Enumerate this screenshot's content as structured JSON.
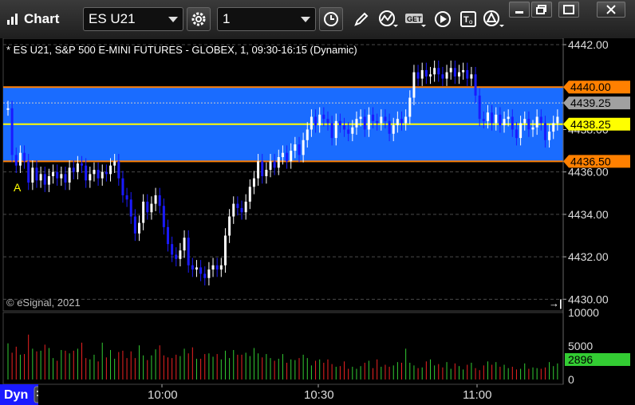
{
  "window": {
    "title": "Chart",
    "symbol": "ES U21",
    "interval": "1",
    "controls": [
      "minimize-icon",
      "restore-icon",
      "maximize-icon",
      "close-icon"
    ]
  },
  "toolbar": {
    "icons": [
      "settings-gear-icon",
      "clock-icon",
      "pencil-icon",
      "study-icon",
      "get-icon",
      "play-icon",
      "text-icon",
      "alert-icon"
    ]
  },
  "chart": {
    "header": "* ES U21, S&P 500 E-MINI FUTURES - GLOBEX, 1, 09:30-16:15 (Dynamic)",
    "copyright": "© eSignal, 2021",
    "marker": "A",
    "price_labels": [
      {
        "text": "4440.00",
        "bg": "#ff8000",
        "fg": "#000000"
      },
      {
        "text": "4439.25",
        "bg": "#a0a0a0",
        "fg": "#000000"
      },
      {
        "text": "4438.25",
        "bg": "#ffff00",
        "fg": "#000000"
      },
      {
        "text": "4436.50",
        "bg": "#ff8000",
        "fg": "#000000"
      }
    ],
    "volume_last": "2896",
    "footer_label": "Dyn",
    "colors": {
      "up": "#ffffff",
      "down": "#1a1aff",
      "zone": "#1a6cff",
      "zone_line": "#ff8000",
      "last_line": "#ffff00",
      "grid": "#4a4a4a"
    }
  },
  "chart_data": {
    "type": "candlestick",
    "title": "* ES U21, S&P 500 E-MINI FUTURES - GLOBEX, 1, 09:30-16:15 (Dynamic)",
    "y_ticks": [
      "4442.00",
      "4438.00",
      "4436.00",
      "4434.00",
      "4432.00",
      "4430.00"
    ],
    "ylim": [
      4429.9,
      4442.0
    ],
    "x_ticks": [
      "10:00",
      "10:30",
      "11:00"
    ],
    "volume_ticks": [
      "10000",
      "5000",
      "0"
    ],
    "zone": {
      "high": 4440.0,
      "low": 4436.5
    },
    "last_price": 4438.25,
    "mid_price": 4439.25,
    "closes": [
      4439.0,
      4436.8,
      4436.3,
      4436.9,
      4436.5,
      4435.5,
      4436.2,
      4435.6,
      4435.9,
      4435.4,
      4435.8,
      4436.0,
      4435.7,
      4435.9,
      4435.5,
      4436.2,
      4436.0,
      4436.4,
      4436.3,
      4435.6,
      4435.9,
      4436.1,
      4435.7,
      4436.0,
      4435.9,
      4436.3,
      4436.5,
      4435.7,
      4434.9,
      4434.7,
      4433.9,
      4433.1,
      4433.6,
      4434.6,
      4434.1,
      4434.5,
      4434.9,
      4434.4,
      4433.4,
      4432.6,
      4432.1,
      4431.9,
      4432.3,
      4432.9,
      4431.6,
      4431.4,
      4431.5,
      4431.2,
      4431.0,
      4431.4,
      4431.6,
      4431.4,
      4431.6,
      4433.0,
      4433.9,
      4434.5,
      4434.3,
      4434.1,
      4434.6,
      4435.3,
      4435.7,
      4436.5,
      4435.8,
      4436.1,
      4436.5,
      4436.2,
      4436.7,
      4436.9,
      4436.5,
      4437.0,
      4437.3,
      4436.8,
      4437.5,
      4438.0,
      4438.6,
      4438.2,
      4438.7,
      4438.5,
      4438.3,
      4437.6,
      4438.4,
      4438.2,
      4438.0,
      4437.8,
      4438.1,
      4438.5,
      4438.6,
      4438.0,
      4438.7,
      4438.4,
      4438.3,
      4438.6,
      4438.4,
      4437.8,
      4438.2,
      4438.5,
      4438.3,
      4438.6,
      4439.5,
      4440.7,
      4440.4,
      4440.8,
      4440.5,
      4440.6,
      4440.9,
      4440.6,
      4440.4,
      4440.7,
      4440.9,
      4440.5,
      4440.7,
      4440.8,
      4440.4,
      4440.6,
      4439.6,
      4438.5,
      4438.4,
      4438.8,
      4438.3,
      4438.7,
      4438.2,
      4438.5,
      4438.6,
      4438.0,
      4437.6,
      4438.3,
      4438.5,
      4438.0,
      4438.1,
      4438.6,
      4438.3,
      4437.5,
      4437.9,
      4438.3,
      4438.6
    ],
    "volumes": [
      5400,
      4000,
      4900,
      3700,
      3800,
      6700,
      4600,
      4200,
      4300,
      5200,
      4700,
      3200,
      2800,
      4400,
      4300,
      3900,
      4300,
      4600,
      5500,
      3200,
      3000,
      3700,
      2700,
      5500,
      3300,
      4400,
      3100,
      4100,
      4300,
      3200,
      4200,
      3200,
      5100,
      3600,
      2900,
      3600,
      4500,
      5100,
      3600,
      3300,
      3200,
      3700,
      3500,
      4600,
      3900,
      4800,
      3100,
      3100,
      3800,
      3900,
      3400,
      3800,
      3000,
      4300,
      3200,
      4400,
      3700,
      3700,
      4000,
      3500,
      4700,
      3900,
      3300,
      3800,
      3200,
      2800,
      3100,
      3800,
      2500,
      3000,
      2900,
      3200,
      3700,
      3200,
      2100,
      2800,
      3000,
      2500,
      3000,
      2300,
      1900,
      2000,
      2700,
      1600,
      1900,
      1600,
      2000,
      2500,
      2800,
      1700,
      3000,
      1900,
      2200,
      1900,
      2100,
      2600,
      2500,
      4600,
      2500,
      2100,
      1700,
      1800,
      2700,
      3000,
      2100,
      2300,
      1800,
      2600,
      1600,
      2400,
      2000,
      1500,
      2200,
      2500,
      1700,
      1400,
      2100,
      2700,
      2200,
      2600,
      1900,
      2200,
      1700,
      1900,
      1500,
      1600,
      2400,
      1600,
      1800,
      1700,
      1600,
      1800,
      2600,
      2000,
      2400,
      2900
    ]
  }
}
